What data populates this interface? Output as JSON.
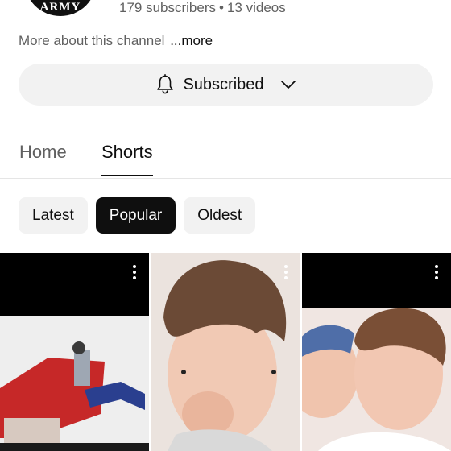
{
  "channel": {
    "avatar_text": "ARMY",
    "subscribers": "179 subscribers",
    "separator": "•",
    "videos": "13 videos",
    "more_prefix": "More about this channel",
    "more_link": "...more"
  },
  "subscribe": {
    "label": "Subscribed",
    "icon": "bell-icon",
    "chevron": "chevron-down-icon"
  },
  "tabs": [
    {
      "label": "Home",
      "active": false
    },
    {
      "label": "Shorts",
      "active": true
    }
  ],
  "filters": [
    {
      "label": "Latest",
      "active": false
    },
    {
      "label": "Popular",
      "active": true
    },
    {
      "label": "Oldest",
      "active": false
    }
  ],
  "shorts": [
    {
      "menu_icon": "more-vert-icon"
    },
    {
      "menu_icon": "more-vert-icon"
    },
    {
      "menu_icon": "more-vert-icon"
    }
  ],
  "colors": {
    "text_primary": "#0f0f0f",
    "text_secondary": "#606060",
    "chip_bg": "#f2f2f2",
    "chip_active_bg": "#0f0f0f"
  }
}
